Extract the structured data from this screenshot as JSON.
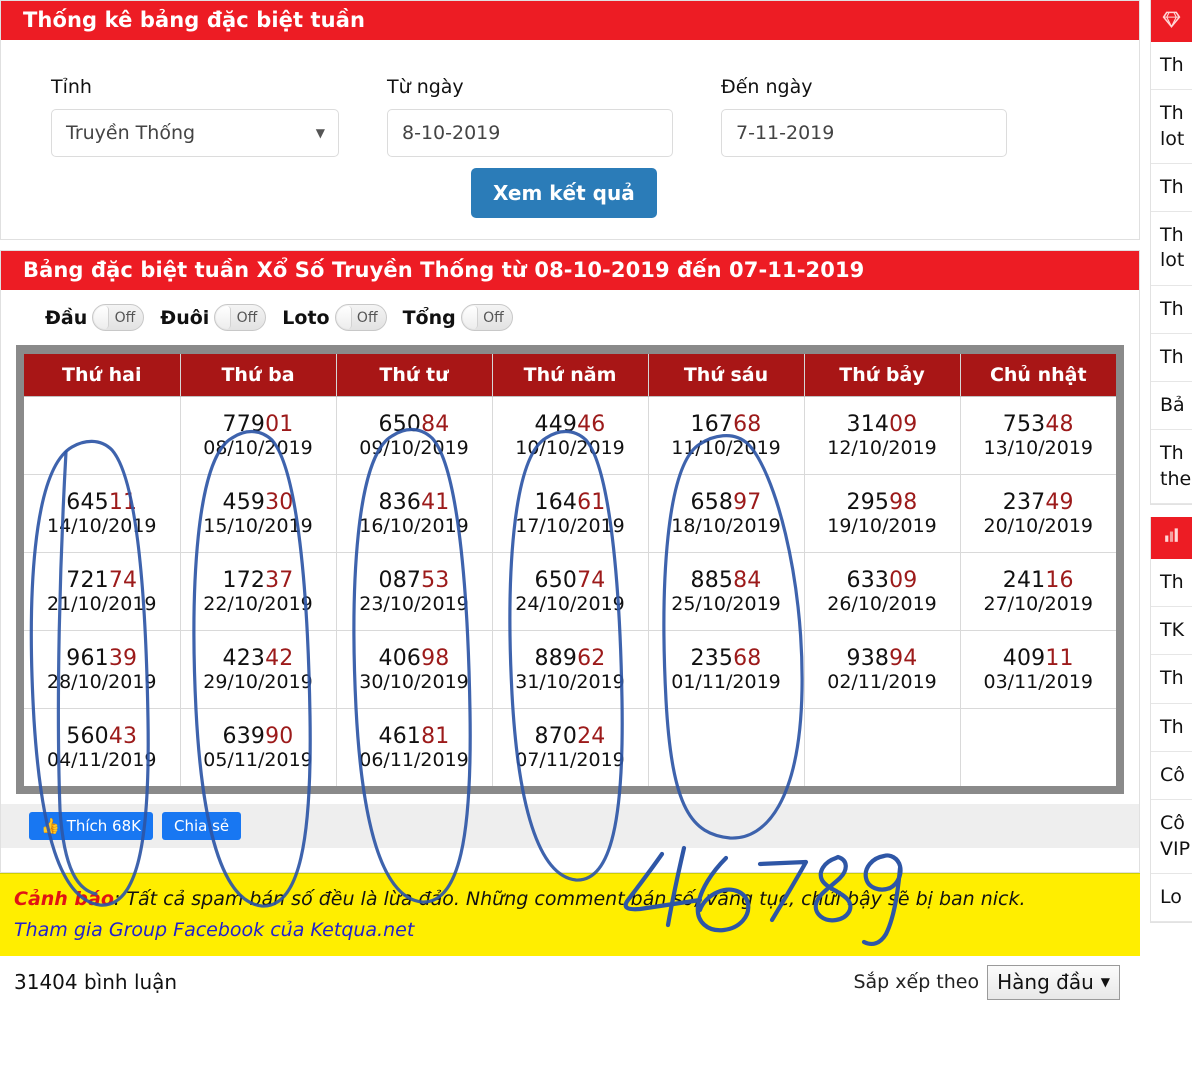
{
  "search_panel": {
    "title": "Thống kê bảng đặc biệt tuần",
    "province": {
      "label": "Tỉnh",
      "value": "Truyền Thống",
      "caret": "▼"
    },
    "from_date": {
      "label": "Từ ngày",
      "value": "8-10-2019"
    },
    "to_date": {
      "label": "Đến ngày",
      "value": "7-11-2019"
    },
    "submit_label": "Xem kết quả"
  },
  "table_panel": {
    "title": "Bảng đặc biệt tuần Xổ Số Truyền Thống từ 08-10-2019 đến 07-11-2019",
    "toggles": [
      {
        "label": "Đầu",
        "state": "Off"
      },
      {
        "label": "Đuôi",
        "state": "Off"
      },
      {
        "label": "Loto",
        "state": "Off"
      },
      {
        "label": "Tổng",
        "state": "Off"
      }
    ],
    "columns": [
      "Thứ hai",
      "Thứ ba",
      "Thứ tư",
      "Thứ năm",
      "Thứ sáu",
      "Thứ bảy",
      "Chủ nhật"
    ],
    "rows": [
      [
        {
          "head": "",
          "tail": "",
          "date": "",
          "bg": "none"
        },
        {
          "head": "779",
          "tail": "01",
          "date": "08/10/2019",
          "bg": "none"
        },
        {
          "head": "650",
          "tail": "84",
          "date": "09/10/2019",
          "bg": "none"
        },
        {
          "head": "449",
          "tail": "46",
          "date": "10/10/2019",
          "bg": "none"
        },
        {
          "head": "167",
          "tail": "68",
          "date": "11/10/2019",
          "bg": "none"
        },
        {
          "head": "314",
          "tail": "09",
          "date": "12/10/2019",
          "bg": "weekend"
        },
        {
          "head": "753",
          "tail": "48",
          "date": "13/10/2019",
          "bg": "weekend"
        }
      ],
      [
        {
          "head": "645",
          "tail": "11",
          "date": "14/10/2019",
          "bg": "none"
        },
        {
          "head": "459",
          "tail": "30",
          "date": "15/10/2019",
          "bg": "none"
        },
        {
          "head": "836",
          "tail": "41",
          "date": "16/10/2019",
          "bg": "none"
        },
        {
          "head": "164",
          "tail": "61",
          "date": "17/10/2019",
          "bg": "none"
        },
        {
          "head": "658",
          "tail": "97",
          "date": "18/10/2019",
          "bg": "none"
        },
        {
          "head": "295",
          "tail": "98",
          "date": "19/10/2019",
          "bg": "weekend"
        },
        {
          "head": "237",
          "tail": "49",
          "date": "20/10/2019",
          "bg": "today"
        }
      ],
      [
        {
          "head": "721",
          "tail": "74",
          "date": "21/10/2019",
          "bg": "none"
        },
        {
          "head": "172",
          "tail": "37",
          "date": "22/10/2019",
          "bg": "none"
        },
        {
          "head": "087",
          "tail": "53",
          "date": "23/10/2019",
          "bg": "none"
        },
        {
          "head": "650",
          "tail": "74",
          "date": "24/10/2019",
          "bg": "none"
        },
        {
          "head": "885",
          "tail": "84",
          "date": "25/10/2019",
          "bg": "none"
        },
        {
          "head": "633",
          "tail": "09",
          "date": "26/10/2019",
          "bg": "weekend"
        },
        {
          "head": "241",
          "tail": "16",
          "date": "27/10/2019",
          "bg": "weekend"
        }
      ],
      [
        {
          "head": "961",
          "tail": "39",
          "date": "28/10/2019",
          "bg": "none"
        },
        {
          "head": "423",
          "tail": "42",
          "date": "29/10/2019",
          "bg": "none"
        },
        {
          "head": "406",
          "tail": "98",
          "date": "30/10/2019",
          "bg": "none"
        },
        {
          "head": "889",
          "tail": "62",
          "date": "31/10/2019",
          "bg": "none"
        },
        {
          "head": "235",
          "tail": "68",
          "date": "01/11/2019",
          "bg": "none"
        },
        {
          "head": "938",
          "tail": "94",
          "date": "02/11/2019",
          "bg": "weekend"
        },
        {
          "head": "409",
          "tail": "11",
          "date": "03/11/2019",
          "bg": "weekend"
        }
      ],
      [
        {
          "head": "560",
          "tail": "43",
          "date": "04/11/2019",
          "bg": "none"
        },
        {
          "head": "639",
          "tail": "90",
          "date": "05/11/2019",
          "bg": "none"
        },
        {
          "head": "461",
          "tail": "81",
          "date": "06/11/2019",
          "bg": "none"
        },
        {
          "head": "870",
          "tail": "24",
          "date": "07/11/2019",
          "bg": "none"
        },
        {
          "head": "",
          "tail": "",
          "date": "",
          "bg": "none"
        },
        {
          "head": "",
          "tail": "",
          "date": "",
          "bg": "empty"
        },
        {
          "head": "",
          "tail": "",
          "date": "",
          "bg": "empty"
        }
      ]
    ]
  },
  "social": {
    "like_label": "Thích 68K",
    "share_label": "Chia sẻ",
    "thumb_icon": "👍"
  },
  "warning": {
    "keyword": "Cảnh báo",
    "text": ": Tất cả spam bán số đều là lừa đảo. Những comment bán số, văng tục, chửi bậy sẽ bị ban nick.",
    "link": "Tham gia Group Facebook của Ketqua.net"
  },
  "comments": {
    "count_label": "31404 bình luận",
    "sort_label": "Sắp xếp theo",
    "sort_value": "Hàng đầu",
    "caret": "▼"
  },
  "annotation": {
    "handwritten_number": "46789",
    "ink_color": "#2e56a6"
  },
  "sidebar": {
    "block1": {
      "icon": "gem-icon",
      "items": [
        "Th",
        "Th\nlot",
        "Th",
        "Th\nlot",
        "Th",
        "Th",
        "Bả",
        "Th\nthe"
      ]
    },
    "block2": {
      "icon": "chart-icon",
      "items": [
        "Th",
        "TK",
        "Th",
        "Th",
        "Cô",
        "Cô\nVIP",
        "Lo"
      ]
    }
  },
  "colors": {
    "brand_red": "#ed1c24",
    "table_header_red": "#a81616",
    "accent_blue": "#2b7cb8",
    "tail_red": "#9c1a1a",
    "weekend_green": "#dff0d8",
    "today_orange": "#fde8a8",
    "warning_yellow": "#ffee00",
    "facebook_blue": "#1877f2"
  }
}
